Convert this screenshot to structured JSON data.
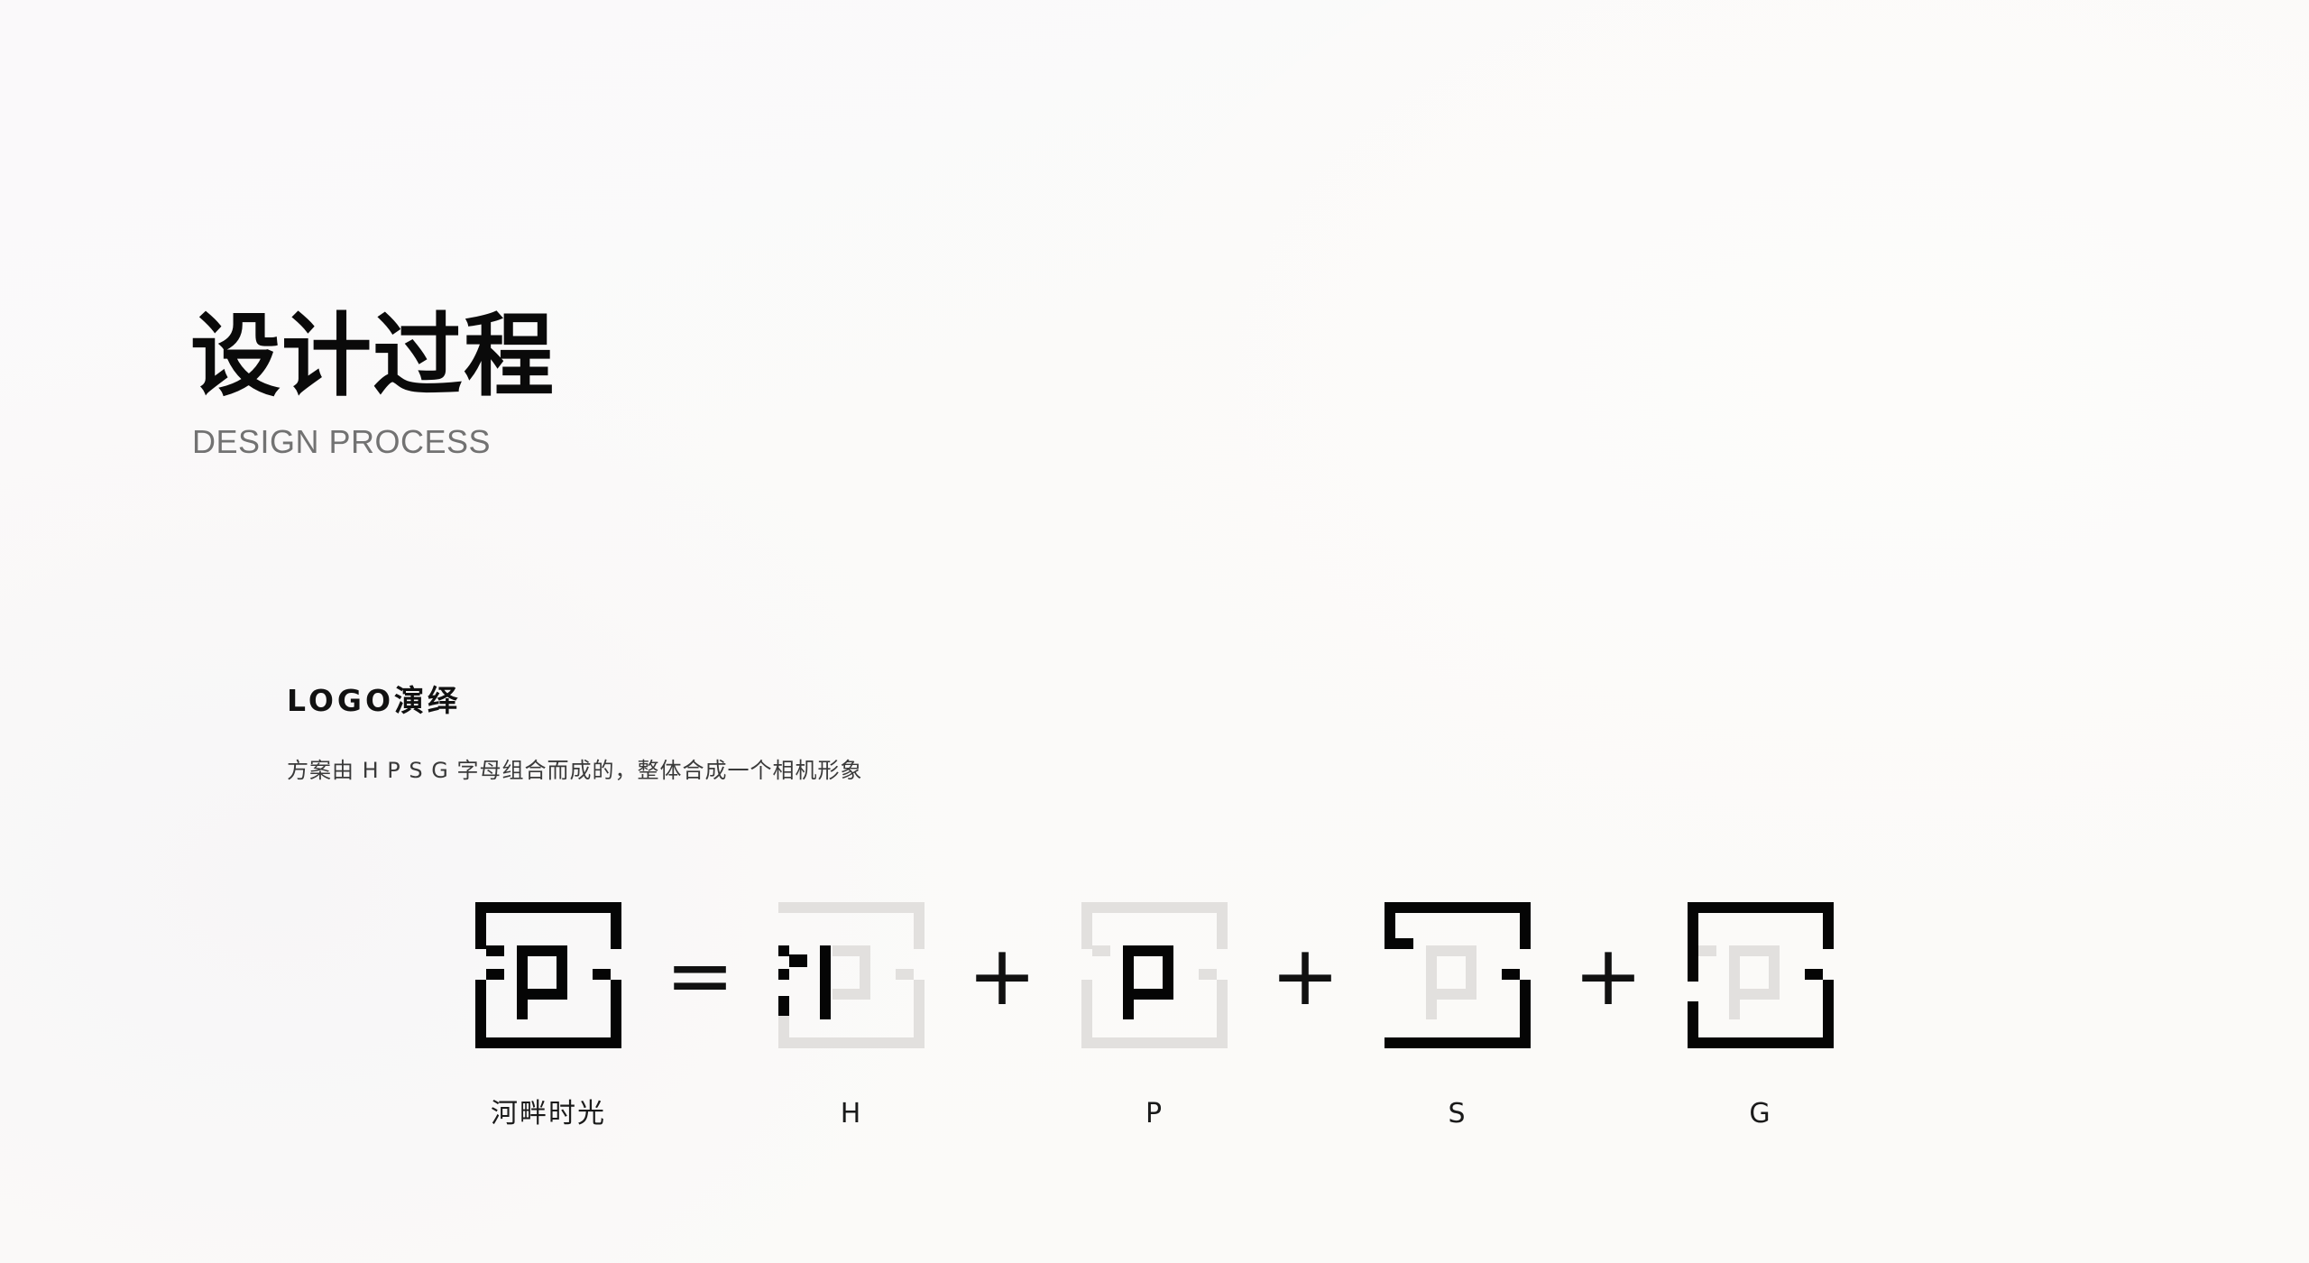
{
  "header": {
    "title": "设计过程",
    "subtitle": "DESIGN PROCESS"
  },
  "section": {
    "title": "LOGO演绎",
    "description": "方案由 H P S G 字母组合而成的，整体合成一个相机形象"
  },
  "equation": {
    "items": [
      {
        "caption": "河畔时光",
        "icon": "combined-logo-icon"
      },
      {
        "caption": "H",
        "icon": "letter-h-logo-icon"
      },
      {
        "caption": "P",
        "icon": "letter-p-logo-icon"
      },
      {
        "caption": "S",
        "icon": "letter-s-logo-icon"
      },
      {
        "caption": "G",
        "icon": "letter-g-logo-icon"
      }
    ],
    "operators": [
      "=",
      "+",
      "+",
      "+"
    ]
  },
  "colors": {
    "active": "#050505",
    "ghost": "#e2e0de",
    "title": "#0a0a0a",
    "subtitle": "#727272"
  }
}
